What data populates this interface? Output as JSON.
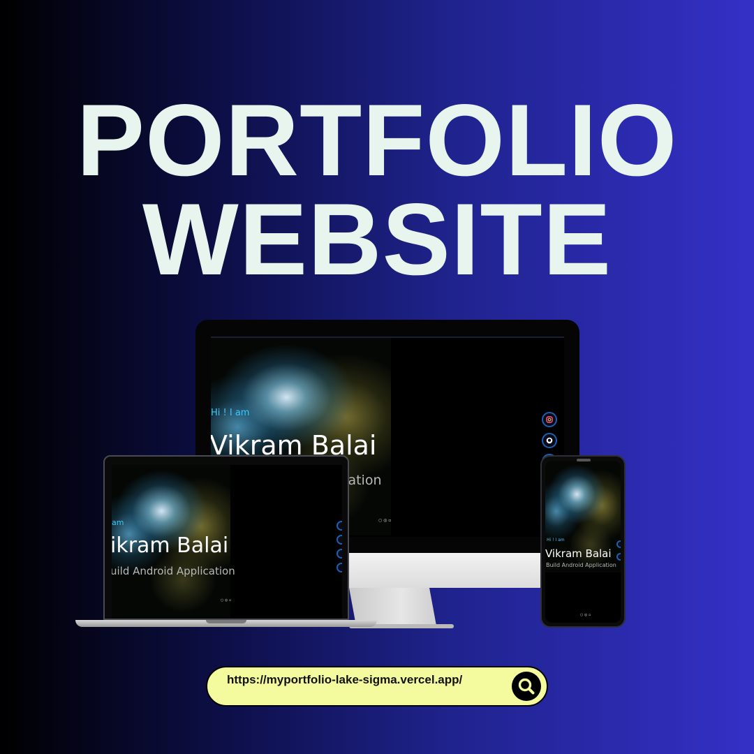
{
  "headline": {
    "line1": "PORTFOLIO",
    "line2": "WEBSITE"
  },
  "site_preview": {
    "greeting": "Hi ! I am",
    "name": "Vikram Balai",
    "role": "Build Android Application",
    "monitor_greeting": "Hi ! I am",
    "monitor_name": "Vikram Balai",
    "monitor_role": "cation",
    "laptop_greeting": "am",
    "laptop_name": "ikram Balai",
    "laptop_role": "uild Android Application",
    "phone_greeting": "Hi ! I am",
    "phone_name": "Vikram Balai",
    "phone_role": "Build Android Application"
  },
  "url": {
    "text": "https://myportfolio-lake-sigma.vercel.app/"
  },
  "colors": {
    "url_bar_bg": "#f4fa9e",
    "headline": "#e8f5ee",
    "accent": "#3cc9ff"
  },
  "icons": [
    "instagram-icon",
    "github-icon",
    "linkedin-icon",
    "search-icon"
  ]
}
